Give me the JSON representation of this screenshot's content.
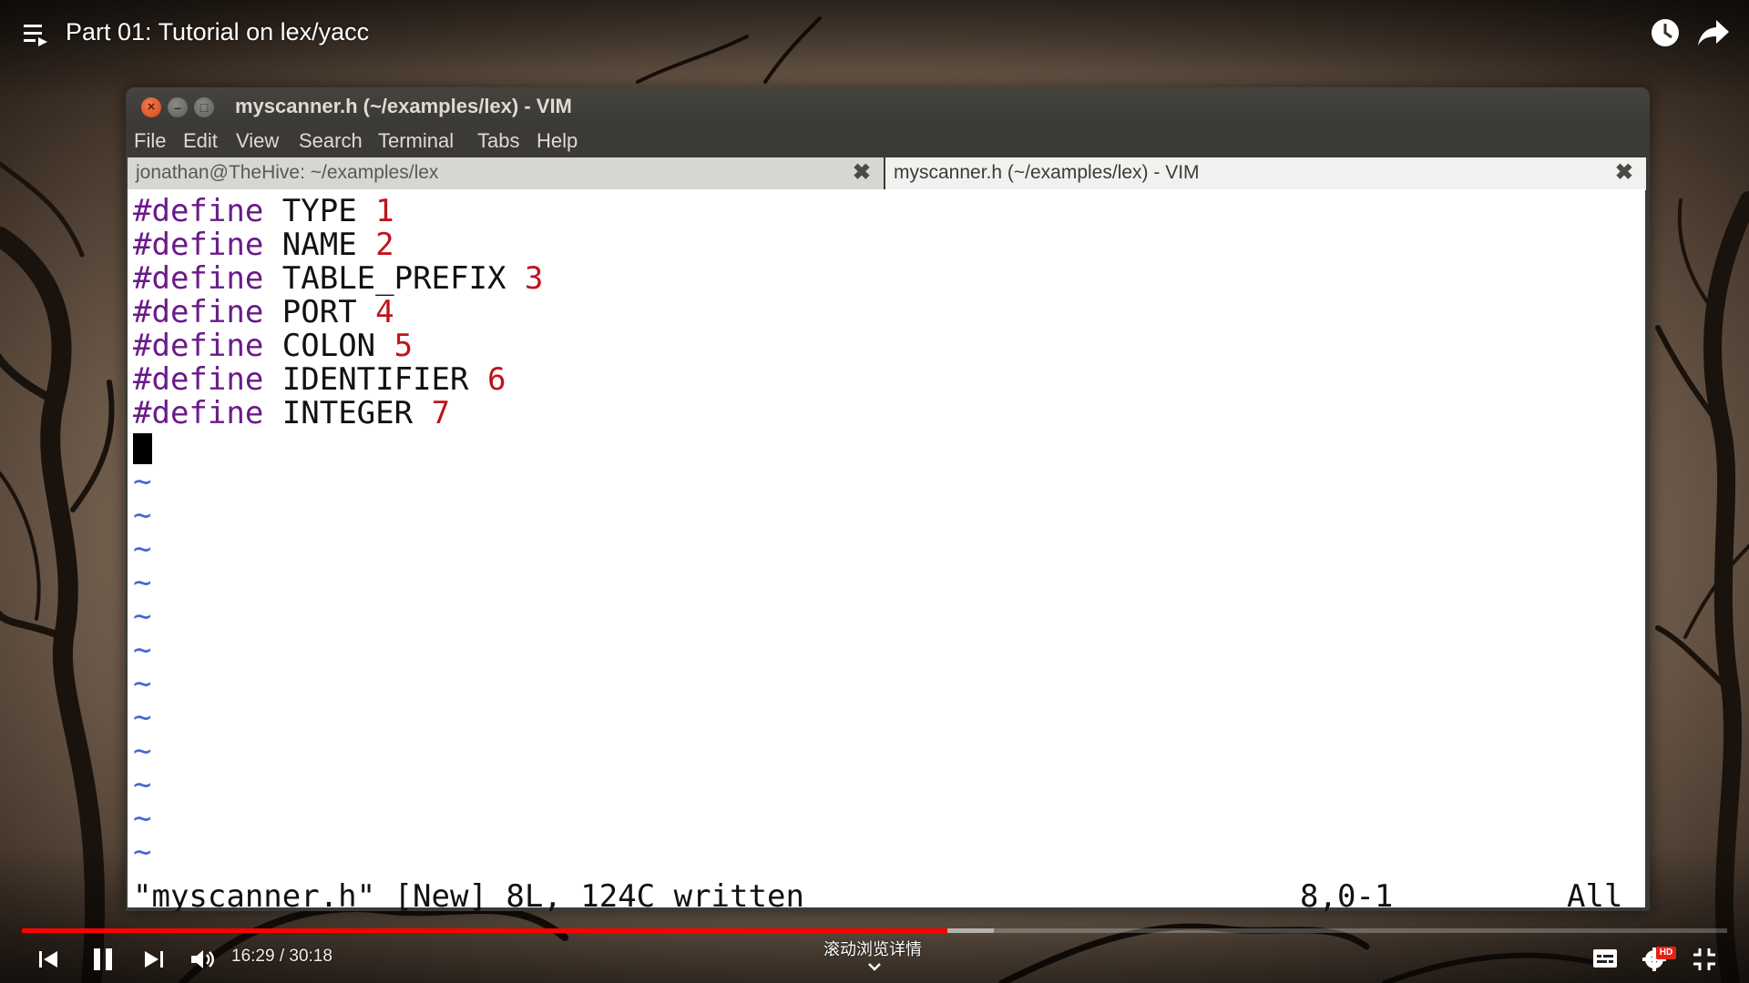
{
  "video": {
    "title": "Part 01: Tutorial on lex/yacc",
    "time_current": "16:29",
    "time_total": "30:18",
    "time_display": "16:29 / 30:18",
    "progress_played": 0.543,
    "progress_loaded": 0.57,
    "scroll_hint": "滚动浏览详情",
    "hd_badge": "HD"
  },
  "window": {
    "title": "myscanner.h (~/examples/lex) - VIM",
    "menu": [
      "File",
      "Edit",
      "View",
      "Search",
      "Terminal",
      "Tabs",
      "Help"
    ],
    "tabs": [
      {
        "label": "jonathan@TheHive: ~/examples/lex",
        "active": false
      },
      {
        "label": "myscanner.h (~/examples/lex) - VIM",
        "active": true
      }
    ]
  },
  "editor": {
    "lines": [
      {
        "keyword": "#define",
        "name": "TYPE",
        "value": "1"
      },
      {
        "keyword": "#define",
        "name": "NAME",
        "value": "2"
      },
      {
        "keyword": "#define",
        "name": "TABLE_PREFIX",
        "value": "3"
      },
      {
        "keyword": "#define",
        "name": "PORT",
        "value": "4"
      },
      {
        "keyword": "#define",
        "name": "COLON",
        "value": "5"
      },
      {
        "keyword": "#define",
        "name": "IDENTIFIER",
        "value": "6"
      },
      {
        "keyword": "#define",
        "name": "INTEGER",
        "value": "7"
      }
    ],
    "tilde": "~",
    "tilde_count": 12,
    "status_message": "\"myscanner.h\" [New] 8L, 124C written",
    "cursor_position": "8,0-1",
    "scroll_position": "All"
  },
  "colors": {
    "keyword": "#6a1a8a",
    "number": "#c0121b",
    "tilde": "#4a64d0",
    "progress": "#ff0000"
  }
}
